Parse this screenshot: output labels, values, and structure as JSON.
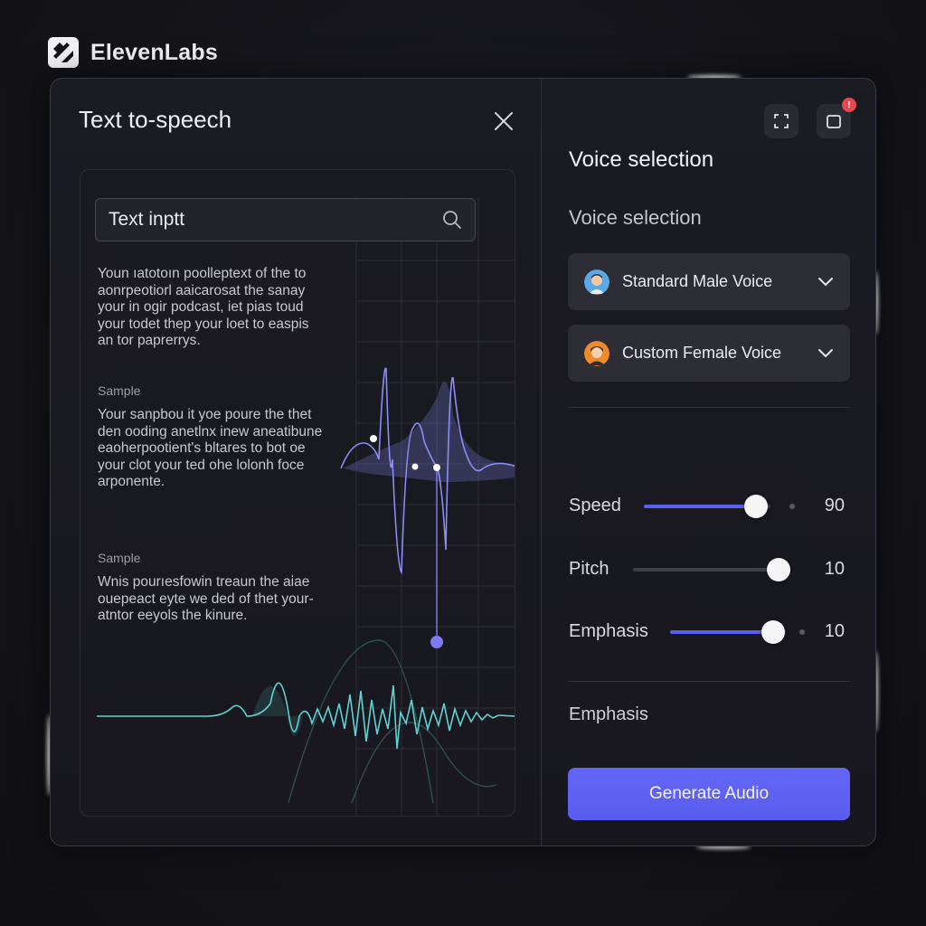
{
  "app": {
    "brand": "ElevenLabs"
  },
  "left": {
    "title": "Text to-speech",
    "search": {
      "value": "Text inptt"
    },
    "blocks": [
      {
        "label": "",
        "lines": [
          "Youn ıatotoın poolleptext of the to",
          "aonrpeotiorl aaicarosat the sanay",
          "your in ogir podcast, iet pias toud",
          "your todet thep your loet to easpis",
          "an tor paprerrys."
        ]
      },
      {
        "label": "Sample",
        "lines": [
          "Your sanpbou it yoe poure the thet",
          "den ooding anetlnx inew aneatibune",
          "eaoherpootient's bltares to bot oe",
          "your clot your ted ohe lolonh foce",
          "arponente."
        ]
      },
      {
        "label": "Sample",
        "lines": [
          "Wnis pourıesfowin treaun the aiae",
          "ouepeact eyte we ded of thet your-",
          "atntor eeyols the kinure."
        ]
      }
    ]
  },
  "right": {
    "title": "Voice selection",
    "subtitle": "Voice selection",
    "notification_count": "!",
    "voices": [
      {
        "label": "Standard Male Voice"
      },
      {
        "label": "Custom Female Voice"
      }
    ],
    "sliders": [
      {
        "label": "Speed",
        "value": "90",
        "fraction": 0.9
      },
      {
        "label": "Pitch",
        "value": "10",
        "fraction": 1.0
      },
      {
        "label": "Emphasis",
        "value": "10",
        "fraction": 0.9
      }
    ],
    "emphasis_label": "Emphasis",
    "generate_label": "Generate Audio"
  },
  "colors": {
    "accent": "#5b5ef2",
    "waveform_teal": "#5fd3d3",
    "waveform_violet": "#8b8cf7"
  }
}
